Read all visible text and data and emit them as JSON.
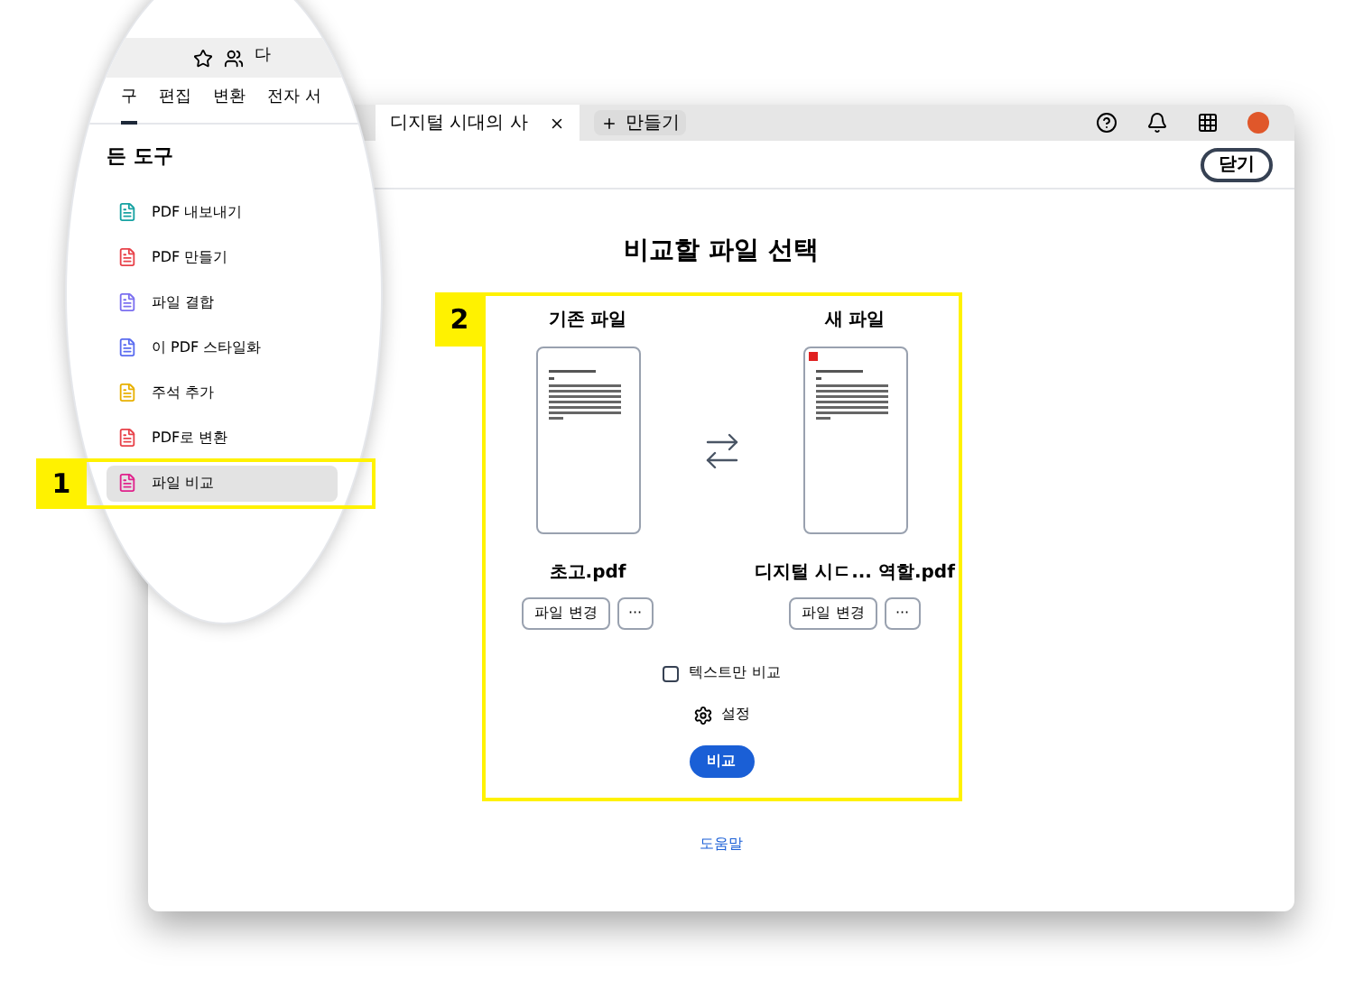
{
  "magnifier": {
    "tab_strip_text": "다",
    "menu": [
      {
        "label": "구",
        "selected": true
      },
      {
        "label": "편집",
        "selected": false
      },
      {
        "label": "변환",
        "selected": false
      },
      {
        "label": "전자 서",
        "selected": false
      }
    ],
    "heading": "든 도구",
    "tools": [
      {
        "label": "PDF 내보내기",
        "color": "#17a2a2",
        "selected": false
      },
      {
        "label": "PDF 만들기",
        "color": "#e8424a",
        "selected": false
      },
      {
        "label": "파일 결합",
        "color": "#7b6ff0",
        "selected": false
      },
      {
        "label": "이 PDF 스타일화",
        "color": "#5a6cf0",
        "selected": false
      },
      {
        "label": "주석 추가",
        "color": "#e8b000",
        "selected": false
      },
      {
        "label": "PDF로 변환",
        "color": "#e8424a",
        "selected": false
      },
      {
        "label": "파일 비교",
        "color": "#e0228c",
        "selected": true
      }
    ]
  },
  "tabs": [
    {
      "label": "디지털 시대의 사",
      "selected": true
    }
  ],
  "new_tab": "만들기",
  "close_button": "닫기",
  "title": "비교할 파일 선택",
  "files": [
    {
      "heading": "기존 파일",
      "name": "초고.pdf",
      "change": "파일 변경",
      "more": "···",
      "changed": false
    },
    {
      "heading": "새 파일",
      "name": "디지털 시ㄷ... 역할.pdf",
      "change": "파일 변경",
      "more": "···",
      "changed": true
    }
  ],
  "text_only": {
    "label": "텍스트만 비교",
    "checked": false
  },
  "settings": "설정",
  "compare_button": "비교",
  "help_link": "도움말",
  "callouts": [
    "1",
    "2"
  ]
}
